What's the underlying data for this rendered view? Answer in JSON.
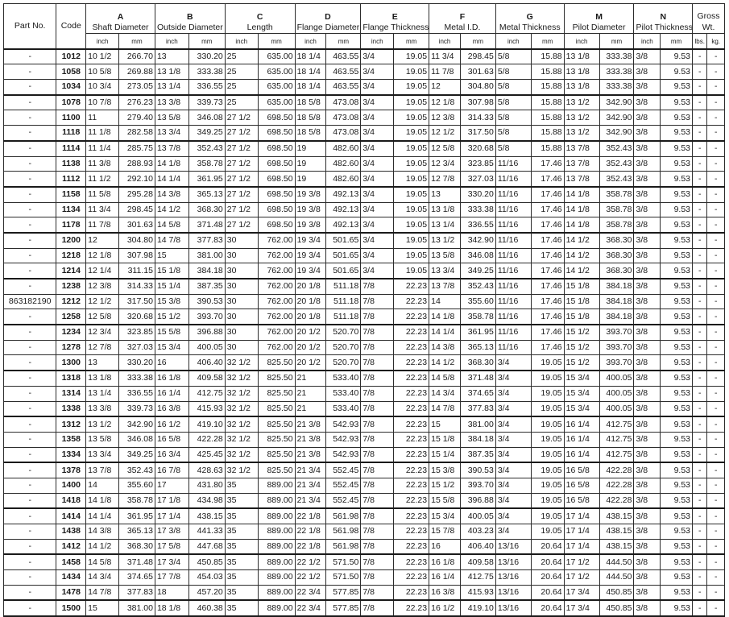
{
  "headers": [
    {
      "letter": "",
      "title": "Part No."
    },
    {
      "letter": "",
      "title": "Code"
    },
    {
      "letter": "A",
      "title": "Shaft Diameter"
    },
    {
      "letter": "B",
      "title": "Outside Diameter"
    },
    {
      "letter": "C",
      "title": "Length"
    },
    {
      "letter": "D",
      "title": "Flange Diameter"
    },
    {
      "letter": "E",
      "title": "Flange Thickness"
    },
    {
      "letter": "F",
      "title": "Metal I.D."
    },
    {
      "letter": "G",
      "title": "Metal Thickness"
    },
    {
      "letter": "M",
      "title": "Pilot Diameter"
    },
    {
      "letter": "N",
      "title": "Pilot Thickness"
    },
    {
      "letter": "",
      "title": "Gross Wt."
    }
  ],
  "units": [
    "inch",
    "mm",
    "inch",
    "mm",
    "inch",
    "mm",
    "inch",
    "mm",
    "inch",
    "mm",
    "inch",
    "mm",
    "inch",
    "mm",
    "inch",
    "mm",
    "inch",
    "mm",
    "lbs.",
    "kg."
  ],
  "groups": [
    [
      [
        "-",
        "1012",
        "10 1/2",
        "266.70",
        "13",
        "330.20",
        "25",
        "635.00",
        "18 1/4",
        "463.55",
        "3/4",
        "19.05",
        "11 3/4",
        "298.45",
        "5/8",
        "15.88",
        "13 1/8",
        "333.38",
        "3/8",
        "9.53",
        "-",
        "-"
      ],
      [
        "-",
        "1058",
        "10 5/8",
        "269.88",
        "13 1/8",
        "333.38",
        "25",
        "635.00",
        "18 1/4",
        "463.55",
        "3/4",
        "19.05",
        "11 7/8",
        "301.63",
        "5/8",
        "15.88",
        "13 1/8",
        "333.38",
        "3/8",
        "9.53",
        "-",
        "-"
      ],
      [
        "-",
        "1034",
        "10 3/4",
        "273.05",
        "13 1/4",
        "336.55",
        "25",
        "635.00",
        "18 1/4",
        "463.55",
        "3/4",
        "19.05",
        "12",
        "304.80",
        "5/8",
        "15.88",
        "13 1/8",
        "333.38",
        "3/8",
        "9.53",
        "-",
        "-"
      ]
    ],
    [
      [
        "-",
        "1078",
        "10 7/8",
        "276.23",
        "13 3/8",
        "339.73",
        "25",
        "635.00",
        "18 5/8",
        "473.08",
        "3/4",
        "19.05",
        "12 1/8",
        "307.98",
        "5/8",
        "15.88",
        "13 1/2",
        "342.90",
        "3/8",
        "9.53",
        "-",
        "-"
      ],
      [
        "-",
        "1100",
        "11",
        "279.40",
        "13 5/8",
        "346.08",
        "27 1/2",
        "698.50",
        "18 5/8",
        "473.08",
        "3/4",
        "19.05",
        "12 3/8",
        "314.33",
        "5/8",
        "15.88",
        "13 1/2",
        "342.90",
        "3/8",
        "9.53",
        "-",
        "-"
      ],
      [
        "-",
        "1118",
        "11 1/8",
        "282.58",
        "13 3/4",
        "349.25",
        "27 1/2",
        "698.50",
        "18 5/8",
        "473.08",
        "3/4",
        "19.05",
        "12 1/2",
        "317.50",
        "5/8",
        "15.88",
        "13 1/2",
        "342.90",
        "3/8",
        "9.53",
        "-",
        "-"
      ]
    ],
    [
      [
        "-",
        "1114",
        "11 1/4",
        "285.75",
        "13 7/8",
        "352.43",
        "27 1/2",
        "698.50",
        "19",
        "482.60",
        "3/4",
        "19.05",
        "12 5/8",
        "320.68",
        "5/8",
        "15.88",
        "13 7/8",
        "352.43",
        "3/8",
        "9.53",
        "-",
        "-"
      ],
      [
        "-",
        "1138",
        "11 3/8",
        "288.93",
        "14 1/8",
        "358.78",
        "27 1/2",
        "698.50",
        "19",
        "482.60",
        "3/4",
        "19.05",
        "12 3/4",
        "323.85",
        "11/16",
        "17.46",
        "13 7/8",
        "352.43",
        "3/8",
        "9.53",
        "-",
        "-"
      ],
      [
        "-",
        "1112",
        "11 1/2",
        "292.10",
        "14 1/4",
        "361.95",
        "27 1/2",
        "698.50",
        "19",
        "482.60",
        "3/4",
        "19.05",
        "12 7/8",
        "327.03",
        "11/16",
        "17.46",
        "13 7/8",
        "352.43",
        "3/8",
        "9.53",
        "-",
        "-"
      ]
    ],
    [
      [
        "-",
        "1158",
        "11 5/8",
        "295.28",
        "14 3/8",
        "365.13",
        "27 1/2",
        "698.50",
        "19 3/8",
        "492.13",
        "3/4",
        "19.05",
        "13",
        "330.20",
        "11/16",
        "17.46",
        "14 1/8",
        "358.78",
        "3/8",
        "9.53",
        "-",
        "-"
      ],
      [
        "-",
        "1134",
        "11 3/4",
        "298.45",
        "14 1/2",
        "368.30",
        "27 1/2",
        "698.50",
        "19 3/8",
        "492.13",
        "3/4",
        "19.05",
        "13 1/8",
        "333.38",
        "11/16",
        "17.46",
        "14 1/8",
        "358.78",
        "3/8",
        "9.53",
        "-",
        "-"
      ],
      [
        "-",
        "1178",
        "11 7/8",
        "301.63",
        "14 5/8",
        "371.48",
        "27 1/2",
        "698.50",
        "19 3/8",
        "492.13",
        "3/4",
        "19.05",
        "13 1/4",
        "336.55",
        "11/16",
        "17.46",
        "14 1/8",
        "358.78",
        "3/8",
        "9.53",
        "-",
        "-"
      ]
    ],
    [
      [
        "-",
        "1200",
        "12",
        "304.80",
        "14 7/8",
        "377.83",
        "30",
        "762.00",
        "19 3/4",
        "501.65",
        "3/4",
        "19.05",
        "13 1/2",
        "342.90",
        "11/16",
        "17.46",
        "14 1/2",
        "368.30",
        "3/8",
        "9.53",
        "-",
        "-"
      ],
      [
        "-",
        "1218",
        "12 1/8",
        "307.98",
        "15",
        "381.00",
        "30",
        "762.00",
        "19 3/4",
        "501.65",
        "3/4",
        "19.05",
        "13 5/8",
        "346.08",
        "11/16",
        "17.46",
        "14 1/2",
        "368.30",
        "3/8",
        "9.53",
        "-",
        "-"
      ],
      [
        "-",
        "1214",
        "12 1/4",
        "311.15",
        "15 1/8",
        "384.18",
        "30",
        "762.00",
        "19 3/4",
        "501.65",
        "3/4",
        "19.05",
        "13 3/4",
        "349.25",
        "11/16",
        "17.46",
        "14 1/2",
        "368.30",
        "3/8",
        "9.53",
        "-",
        "-"
      ]
    ],
    [
      [
        "-",
        "1238",
        "12 3/8",
        "314.33",
        "15 1/4",
        "387.35",
        "30",
        "762.00",
        "20 1/8",
        "511.18",
        "7/8",
        "22.23",
        "13 7/8",
        "352.43",
        "11/16",
        "17.46",
        "15 1/8",
        "384.18",
        "3/8",
        "9.53",
        "-",
        "-"
      ],
      [
        "863182190",
        "1212",
        "12 1/2",
        "317.50",
        "15 3/8",
        "390.53",
        "30",
        "762.00",
        "20 1/8",
        "511.18",
        "7/8",
        "22.23",
        "14",
        "355.60",
        "11/16",
        "17.46",
        "15 1/8",
        "384.18",
        "3/8",
        "9.53",
        "-",
        "-"
      ],
      [
        "-",
        "1258",
        "12 5/8",
        "320.68",
        "15 1/2",
        "393.70",
        "30",
        "762.00",
        "20 1/8",
        "511.18",
        "7/8",
        "22.23",
        "14 1/8",
        "358.78",
        "11/16",
        "17.46",
        "15 1/8",
        "384.18",
        "3/8",
        "9.53",
        "-",
        "-"
      ]
    ],
    [
      [
        "-",
        "1234",
        "12 3/4",
        "323.85",
        "15 5/8",
        "396.88",
        "30",
        "762.00",
        "20 1/2",
        "520.70",
        "7/8",
        "22.23",
        "14 1/4",
        "361.95",
        "11/16",
        "17.46",
        "15 1/2",
        "393.70",
        "3/8",
        "9.53",
        "-",
        "-"
      ],
      [
        "-",
        "1278",
        "12 7/8",
        "327.03",
        "15 3/4",
        "400.05",
        "30",
        "762.00",
        "20 1/2",
        "520.70",
        "7/8",
        "22.23",
        "14 3/8",
        "365.13",
        "11/16",
        "17.46",
        "15 1/2",
        "393.70",
        "3/8",
        "9.53",
        "-",
        "-"
      ],
      [
        "-",
        "1300",
        "13",
        "330.20",
        "16",
        "406.40",
        "32 1/2",
        "825.50",
        "20 1/2",
        "520.70",
        "7/8",
        "22.23",
        "14 1/2",
        "368.30",
        "3/4",
        "19.05",
        "15 1/2",
        "393.70",
        "3/8",
        "9.53",
        "-",
        "-"
      ]
    ],
    [
      [
        "-",
        "1318",
        "13 1/8",
        "333.38",
        "16 1/8",
        "409.58",
        "32 1/2",
        "825.50",
        "21",
        "533.40",
        "7/8",
        "22.23",
        "14 5/8",
        "371.48",
        "3/4",
        "19.05",
        "15 3/4",
        "400.05",
        "3/8",
        "9.53",
        "-",
        "-"
      ],
      [
        "-",
        "1314",
        "13 1/4",
        "336.55",
        "16 1/4",
        "412.75",
        "32 1/2",
        "825.50",
        "21",
        "533.40",
        "7/8",
        "22.23",
        "14 3/4",
        "374.65",
        "3/4",
        "19.05",
        "15 3/4",
        "400.05",
        "3/8",
        "9.53",
        "-",
        "-"
      ],
      [
        "-",
        "1338",
        "13 3/8",
        "339.73",
        "16 3/8",
        "415.93",
        "32 1/2",
        "825.50",
        "21",
        "533.40",
        "7/8",
        "22.23",
        "14 7/8",
        "377.83",
        "3/4",
        "19.05",
        "15 3/4",
        "400.05",
        "3/8",
        "9.53",
        "-",
        "-"
      ]
    ],
    [
      [
        "-",
        "1312",
        "13 1/2",
        "342.90",
        "16 1/2",
        "419.10",
        "32 1/2",
        "825.50",
        "21 3/8",
        "542.93",
        "7/8",
        "22.23",
        "15",
        "381.00",
        "3/4",
        "19.05",
        "16 1/4",
        "412.75",
        "3/8",
        "9.53",
        "-",
        "-"
      ],
      [
        "-",
        "1358",
        "13 5/8",
        "346.08",
        "16 5/8",
        "422.28",
        "32 1/2",
        "825.50",
        "21 3/8",
        "542.93",
        "7/8",
        "22.23",
        "15 1/8",
        "384.18",
        "3/4",
        "19.05",
        "16 1/4",
        "412.75",
        "3/8",
        "9.53",
        "-",
        "-"
      ],
      [
        "-",
        "1334",
        "13 3/4",
        "349.25",
        "16 3/4",
        "425.45",
        "32 1/2",
        "825.50",
        "21 3/8",
        "542.93",
        "7/8",
        "22.23",
        "15 1/4",
        "387.35",
        "3/4",
        "19.05",
        "16 1/4",
        "412.75",
        "3/8",
        "9.53",
        "-",
        "-"
      ]
    ],
    [
      [
        "-",
        "1378",
        "13 7/8",
        "352.43",
        "16 7/8",
        "428.63",
        "32 1/2",
        "825.50",
        "21 3/4",
        "552.45",
        "7/8",
        "22.23",
        "15 3/8",
        "390.53",
        "3/4",
        "19.05",
        "16 5/8",
        "422.28",
        "3/8",
        "9.53",
        "-",
        "-"
      ],
      [
        "-",
        "1400",
        "14",
        "355.60",
        "17",
        "431.80",
        "35",
        "889.00",
        "21 3/4",
        "552.45",
        "7/8",
        "22.23",
        "15 1/2",
        "393.70",
        "3/4",
        "19.05",
        "16 5/8",
        "422.28",
        "3/8",
        "9.53",
        "-",
        "-"
      ],
      [
        "-",
        "1418",
        "14 1/8",
        "358.78",
        "17 1/8",
        "434.98",
        "35",
        "889.00",
        "21 3/4",
        "552.45",
        "7/8",
        "22.23",
        "15 5/8",
        "396.88",
        "3/4",
        "19.05",
        "16 5/8",
        "422.28",
        "3/8",
        "9.53",
        "-",
        "-"
      ]
    ],
    [
      [
        "-",
        "1414",
        "14 1/4",
        "361.95",
        "17 1/4",
        "438.15",
        "35",
        "889.00",
        "22 1/8",
        "561.98",
        "7/8",
        "22.23",
        "15 3/4",
        "400.05",
        "3/4",
        "19.05",
        "17 1/4",
        "438.15",
        "3/8",
        "9.53",
        "-",
        "-"
      ],
      [
        "-",
        "1438",
        "14 3/8",
        "365.13",
        "17 3/8",
        "441.33",
        "35",
        "889.00",
        "22 1/8",
        "561.98",
        "7/8",
        "22.23",
        "15 7/8",
        "403.23",
        "3/4",
        "19.05",
        "17 1/4",
        "438.15",
        "3/8",
        "9.53",
        "-",
        "-"
      ],
      [
        "-",
        "1412",
        "14 1/2",
        "368.30",
        "17 5/8",
        "447.68",
        "35",
        "889.00",
        "22 1/8",
        "561.98",
        "7/8",
        "22.23",
        "16",
        "406.40",
        "13/16",
        "20.64",
        "17 1/4",
        "438.15",
        "3/8",
        "9.53",
        "-",
        "-"
      ]
    ],
    [
      [
        "-",
        "1458",
        "14 5/8",
        "371.48",
        "17 3/4",
        "450.85",
        "35",
        "889.00",
        "22 1/2",
        "571.50",
        "7/8",
        "22.23",
        "16 1/8",
        "409.58",
        "13/16",
        "20.64",
        "17 1/2",
        "444.50",
        "3/8",
        "9.53",
        "-",
        "-"
      ],
      [
        "-",
        "1434",
        "14 3/4",
        "374.65",
        "17 7/8",
        "454.03",
        "35",
        "889.00",
        "22 1/2",
        "571.50",
        "7/8",
        "22.23",
        "16 1/4",
        "412.75",
        "13/16",
        "20.64",
        "17 1/2",
        "444.50",
        "3/8",
        "9.53",
        "-",
        "-"
      ],
      [
        "-",
        "1478",
        "14 7/8",
        "377.83",
        "18",
        "457.20",
        "35",
        "889.00",
        "22 3/4",
        "577.85",
        "7/8",
        "22.23",
        "16 3/8",
        "415.93",
        "13/16",
        "20.64",
        "17 3/4",
        "450.85",
        "3/8",
        "9.53",
        "-",
        "-"
      ]
    ],
    [
      [
        "-",
        "1500",
        "15",
        "381.00",
        "18 1/8",
        "460.38",
        "35",
        "889.00",
        "22 3/4",
        "577.85",
        "7/8",
        "22.23",
        "16 1/2",
        "419.10",
        "13/16",
        "20.64",
        "17 3/4",
        "450.85",
        "3/8",
        "9.53",
        "-",
        "-"
      ]
    ]
  ]
}
